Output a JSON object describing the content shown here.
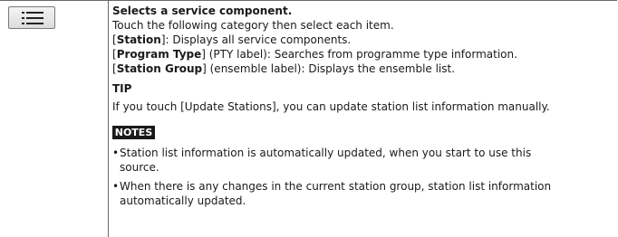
{
  "icon": {
    "name": "list-menu-icon"
  },
  "description": {
    "heading": "Selects a service component.",
    "intro": "Touch the following category then select each item.",
    "items": [
      {
        "open": "[",
        "term": "Station",
        "close": "]",
        "text": ": Displays all service components."
      },
      {
        "open": "[",
        "term": "Program Type",
        "close": "]",
        "text": " (PTY label): Searches from programme type information."
      },
      {
        "open": "[",
        "term": "Station Group",
        "close": "]",
        "text": " (ensemble label): Displays the ensemble list."
      }
    ]
  },
  "tip": {
    "label": "TIP",
    "text": "If you touch [Update Stations], you can update station list information manually."
  },
  "notes": {
    "label": "NOTES",
    "items": [
      {
        "bullet": "•",
        "line1": "Station list information is automatically updated, when you start to use this",
        "line2": "source."
      },
      {
        "bullet": "•",
        "line1": "When there is any changes in the current station group, station list information",
        "line2": "automatically updated."
      }
    ]
  }
}
